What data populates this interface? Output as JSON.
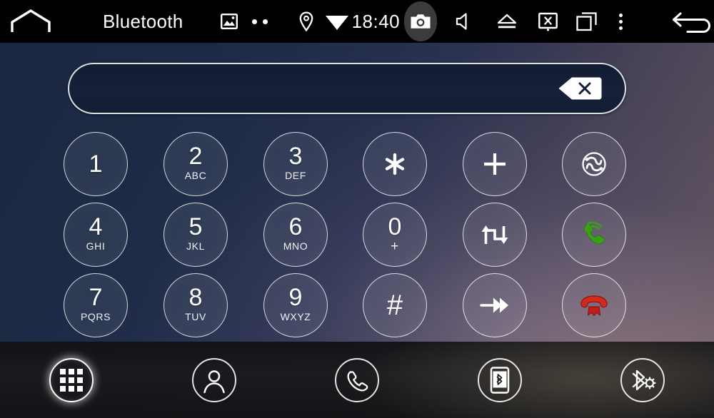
{
  "statusbar": {
    "home_icon": "home-icon",
    "title": "Bluetooth",
    "gallery_icon": "gallery-icon",
    "dots_icon": "two-dots-icon",
    "location_icon": "location-pin-icon",
    "wifi_icon": "wifi-icon",
    "clock": "18:40",
    "camera_icon": "camera-icon",
    "volume_icon": "speaker-mute-icon",
    "eject_icon": "eject-icon",
    "screenoff_icon": "screen-off-icon",
    "recents_icon": "recent-apps-icon",
    "overflow_icon": "overflow-menu-icon",
    "back_icon": "back-arrow-icon",
    "bg_color": "#000000",
    "fg_color": "#ffffff",
    "camera_highlight_color": "#3b3b3b"
  },
  "dialer": {
    "input": {
      "value": "",
      "placeholder": "",
      "backspace_icon": "backspace-delete-icon",
      "border_color": "#ffffff",
      "fill_color": "#16203a"
    },
    "keys": [
      {
        "id": "key-1",
        "digit": "1",
        "letters": "",
        "type": "digit"
      },
      {
        "id": "key-2",
        "digit": "2",
        "letters": "ABC",
        "type": "digit"
      },
      {
        "id": "key-3",
        "digit": "3",
        "letters": "DEF",
        "type": "digit"
      },
      {
        "id": "key-star",
        "digit": "✱",
        "letters": "",
        "type": "symbol",
        "icon": "asterisk-icon"
      },
      {
        "id": "key-plus",
        "digit": "+",
        "letters": "",
        "type": "symbol",
        "icon": "plus-icon"
      },
      {
        "id": "key-swap",
        "digit": "",
        "letters": "",
        "type": "icon",
        "icon": "call-swap-icon"
      },
      {
        "id": "key-4",
        "digit": "4",
        "letters": "GHI",
        "type": "digit"
      },
      {
        "id": "key-5",
        "digit": "5",
        "letters": "JKL",
        "type": "digit"
      },
      {
        "id": "key-6",
        "digit": "6",
        "letters": "MNO",
        "type": "digit"
      },
      {
        "id": "key-0",
        "digit": "0",
        "letters": "+",
        "type": "digit"
      },
      {
        "id": "key-transfer",
        "digit": "",
        "letters": "",
        "type": "icon",
        "icon": "call-transfer-icon"
      },
      {
        "id": "key-answer",
        "digit": "",
        "letters": "",
        "type": "icon",
        "icon": "answer-call-icon",
        "color": "#3b9e16"
      },
      {
        "id": "key-7",
        "digit": "7",
        "letters": "PQRS",
        "type": "digit"
      },
      {
        "id": "key-8",
        "digit": "8",
        "letters": "TUV",
        "type": "digit"
      },
      {
        "id": "key-9",
        "digit": "9",
        "letters": "WXYZ",
        "type": "digit"
      },
      {
        "id": "key-hash",
        "digit": "#",
        "letters": "",
        "type": "symbol",
        "icon": "hash-icon"
      },
      {
        "id": "key-forward",
        "digit": "",
        "letters": "",
        "type": "icon",
        "icon": "fast-forward-icon"
      },
      {
        "id": "key-end",
        "digit": "",
        "letters": "",
        "type": "icon",
        "icon": "end-call-icon",
        "color": "#cc2020"
      }
    ]
  },
  "dock": {
    "items": [
      {
        "id": "dock-dialpad",
        "icon": "dialpad-icon",
        "active": true
      },
      {
        "id": "dock-contacts",
        "icon": "contacts-person-icon",
        "active": false
      },
      {
        "id": "dock-calllog",
        "icon": "phone-handset-icon",
        "active": false
      },
      {
        "id": "dock-btphone",
        "icon": "bluetooth-phone-icon",
        "active": false
      },
      {
        "id": "dock-btsettings",
        "icon": "bluetooth-settings-icon",
        "active": false
      }
    ]
  },
  "theme": {
    "accent_green": "#3b9e16",
    "accent_red": "#cc2020",
    "key_border": "rgba(255,255,255,0.80)",
    "wallpaper_top_left": "#1b2740",
    "wallpaper_bottom_right": "#6b5b60"
  }
}
